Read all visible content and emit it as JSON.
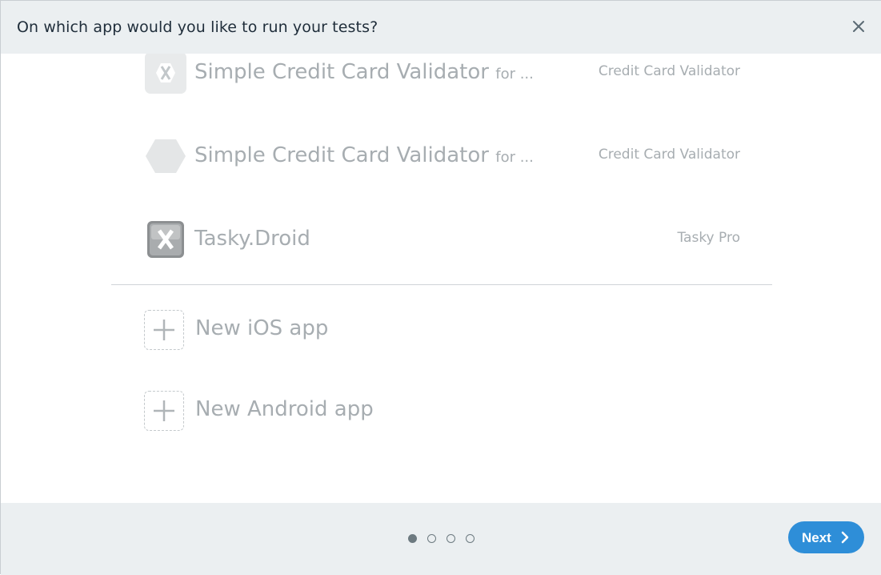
{
  "dialog": {
    "title": "On which app would you like to run your tests?",
    "close_icon": "close-icon"
  },
  "apps": [
    {
      "name": "Simple Credit Card Validator",
      "suffix": "for ...",
      "project": "Credit Card Validator",
      "icon": "xamarin-hexagon-icon"
    },
    {
      "name": "Simple Credit Card Validator",
      "suffix": "for ...",
      "project": "Credit Card Validator",
      "icon": "hexagon-icon"
    },
    {
      "name": "Tasky.Droid",
      "suffix": "",
      "project": "Tasky Pro",
      "icon": "xamarin-app-icon"
    }
  ],
  "new_apps": [
    {
      "label": "New iOS app",
      "icon": "plus-icon"
    },
    {
      "label": "New Android app",
      "icon": "plus-icon"
    }
  ],
  "footer": {
    "pager": {
      "total": 4,
      "current": 1
    },
    "next_label": "Next",
    "next_icon": "chevron-right-icon"
  },
  "colors": {
    "header_bg": "#ebeff1",
    "title_text": "#1f2d3a",
    "muted_text": "#a7adb1",
    "accent": "#2e8ed8",
    "dot": "#6d7a80"
  }
}
